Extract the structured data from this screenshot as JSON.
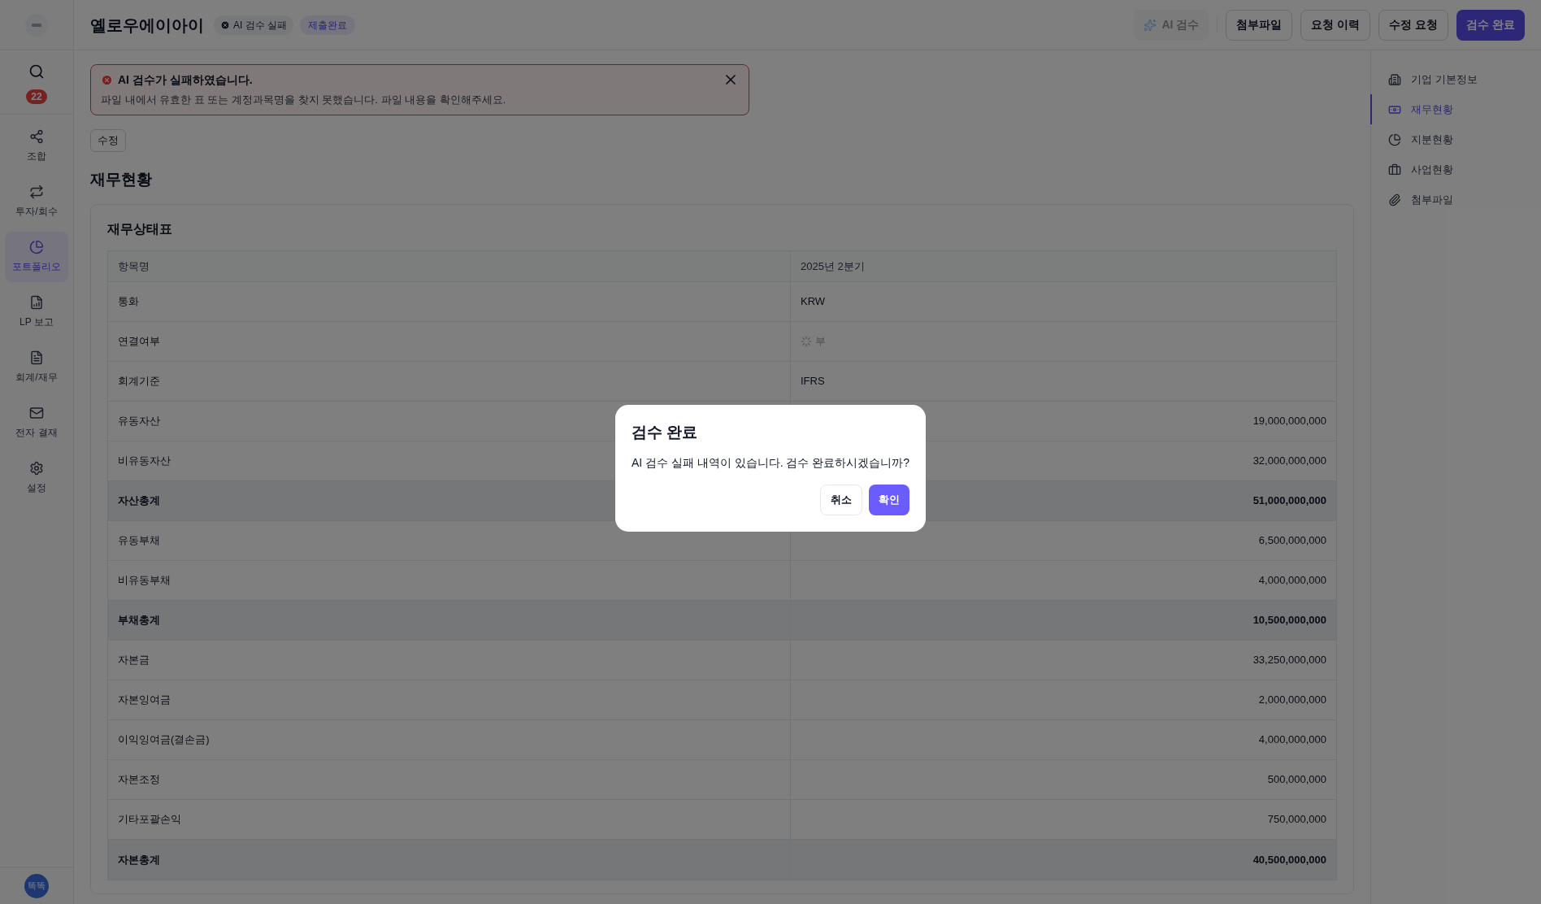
{
  "sidebar": {
    "badge": "22",
    "items": [
      {
        "label": "조합",
        "selected": false
      },
      {
        "label": "투자/회수",
        "selected": false
      },
      {
        "label": "포트폴리오",
        "selected": true
      },
      {
        "label": "LP 보고",
        "selected": false
      },
      {
        "label": "회계/재무",
        "selected": false
      },
      {
        "label": "전자 결재",
        "selected": false
      },
      {
        "label": "설정",
        "selected": false
      }
    ],
    "avatar": "똑똑"
  },
  "header": {
    "title": "옐로우에이아이",
    "badges": [
      {
        "label": "AI 검수 실패",
        "kind": "error"
      },
      {
        "label": "제출완료",
        "kind": "status"
      }
    ],
    "buttons": [
      {
        "label": "AI 검수",
        "kind": "ai",
        "disabled": true
      },
      {
        "label": "첨부파일",
        "kind": "outline",
        "disabled": false
      },
      {
        "label": "요청 이력",
        "kind": "outline",
        "disabled": false
      },
      {
        "label": "수정 요청",
        "kind": "outline",
        "disabled": false
      },
      {
        "label": "검수 완료",
        "kind": "primary",
        "disabled": false
      }
    ]
  },
  "alert": {
    "title": "AI 검수가 실패하였습니다.",
    "message": "파일 내에서 유효한 표 또는 계정과목명을 찾지 못했습니다. 파일 내용을 확인해주세요."
  },
  "edit_button": "수정",
  "section_title": "재무현황",
  "card": {
    "title": "재무상태표",
    "columns": [
      "항목명",
      "2025년 2분기"
    ],
    "rows": [
      {
        "label": "통화",
        "value": "KRW",
        "kind": "text"
      },
      {
        "label": "연결여부",
        "value": "부",
        "kind": "toggle"
      },
      {
        "label": "회계기준",
        "value": "IFRS",
        "kind": "text"
      },
      {
        "label": "유동자산",
        "value": "19,000,000,000",
        "kind": "number"
      },
      {
        "label": "비유동자산",
        "value": "32,000,000,000",
        "kind": "number"
      },
      {
        "label": "자산총계",
        "value": "51,000,000,000",
        "kind": "total"
      },
      {
        "label": "유동부채",
        "value": "6,500,000,000",
        "kind": "number"
      },
      {
        "label": "비유동부채",
        "value": "4,000,000,000",
        "kind": "number"
      },
      {
        "label": "부채총계",
        "value": "10,500,000,000",
        "kind": "total"
      },
      {
        "label": "자본금",
        "value": "33,250,000,000",
        "kind": "number"
      },
      {
        "label": "자본잉여금",
        "value": "2,000,000,000",
        "kind": "number"
      },
      {
        "label": "이익잉여금(결손금)",
        "value": "4,000,000,000",
        "kind": "number"
      },
      {
        "label": "자본조정",
        "value": "500,000,000",
        "kind": "number"
      },
      {
        "label": "기타포괄손익",
        "value": "750,000,000",
        "kind": "number"
      },
      {
        "label": "자본총계",
        "value": "40,500,000,000",
        "kind": "total"
      }
    ]
  },
  "outline": [
    {
      "label": "기업 기본정보",
      "selected": false
    },
    {
      "label": "재무현황",
      "selected": true
    },
    {
      "label": "지분현황",
      "selected": false
    },
    {
      "label": "사업현황",
      "selected": false
    },
    {
      "label": "첨부파일",
      "selected": false
    }
  ],
  "dialog": {
    "title": "검수 완료",
    "message": "AI 검수 실패 내역이 있습니다. 검수 완료하시겠습니까?",
    "buttons": [
      {
        "label": "취소",
        "kind": "cancel"
      },
      {
        "label": "확인",
        "kind": "confirm"
      }
    ]
  }
}
